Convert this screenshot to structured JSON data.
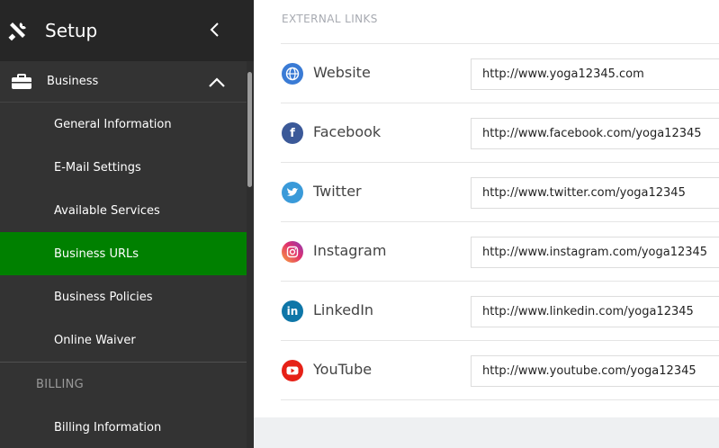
{
  "sidebar": {
    "title": "Setup",
    "section": {
      "label": "Business"
    },
    "items": [
      {
        "label": "General Information",
        "active": false
      },
      {
        "label": "E-Mail Settings",
        "active": false
      },
      {
        "label": "Available Services",
        "active": false
      },
      {
        "label": "Business URLs",
        "active": true
      },
      {
        "label": "Business Policies",
        "active": false
      },
      {
        "label": "Online Waiver",
        "active": false
      }
    ],
    "billing": {
      "label": "BILLING",
      "items": [
        {
          "label": "Billing Information"
        }
      ]
    }
  },
  "main": {
    "section_title": "EXTERNAL LINKS",
    "links": [
      {
        "name": "Website",
        "value": "http://www.yoga12345.com",
        "icon": "globe-icon",
        "color": "#3a7bd5"
      },
      {
        "name": "Facebook",
        "value": "http://www.facebook.com/yoga12345",
        "icon": "facebook-icon",
        "color": "#3b5998"
      },
      {
        "name": "Twitter",
        "value": "http://www.twitter.com/yoga12345",
        "icon": "twitter-icon",
        "color": "#3a9ad9"
      },
      {
        "name": "Instagram",
        "value": "http://www.instagram.com/yoga12345",
        "icon": "instagram-icon",
        "color": "#e1306c"
      },
      {
        "name": "LinkedIn",
        "value": "http://www.linkedin.com/yoga12345",
        "icon": "linkedin-icon",
        "color": "#0e76a8"
      },
      {
        "name": "YouTube",
        "value": "http://www.youtube.com/yoga12345",
        "icon": "youtube-icon",
        "color": "#e62117"
      }
    ]
  },
  "colors": {
    "active_nav": "#008000",
    "sidebar_bg": "#333333",
    "header_bg": "#262626"
  }
}
